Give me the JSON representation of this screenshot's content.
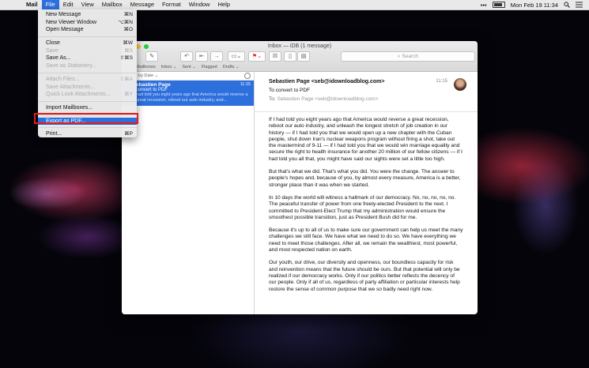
{
  "menubar": {
    "apple_icon": "apple-logo-icon",
    "items": [
      "Mail",
      "File",
      "Edit",
      "View",
      "Mailbox",
      "Message",
      "Format",
      "Window",
      "Help"
    ],
    "active_item": "File",
    "status": {
      "more": "•••",
      "datetime": "Mon Feb 19  11:34",
      "icons": [
        "battery-icon",
        "spotlight-icon",
        "notification-center-icon"
      ]
    }
  },
  "file_menu": {
    "groups": [
      [
        {
          "label": "New Message",
          "shortcut": "⌘N",
          "enabled": true
        },
        {
          "label": "New Viewer Window",
          "shortcut": "⌥⌘N",
          "enabled": true
        },
        {
          "label": "Open Message",
          "shortcut": "⌘O",
          "enabled": true
        }
      ],
      [
        {
          "label": "Close",
          "shortcut": "⌘W",
          "enabled": true
        },
        {
          "label": "Save",
          "shortcut": "⌘S",
          "enabled": false
        },
        {
          "label": "Save As...",
          "shortcut": "⇧⌘S",
          "enabled": true
        },
        {
          "label": "Save as Stationery...",
          "shortcut": "",
          "enabled": false
        }
      ],
      [
        {
          "label": "Attach Files...",
          "shortcut": "⇧⌘A",
          "enabled": false
        },
        {
          "label": "Save Attachments...",
          "shortcut": "",
          "enabled": false
        },
        {
          "label": "Quick Look Attachments...",
          "shortcut": "⌘Y",
          "enabled": false
        }
      ],
      [
        {
          "label": "Import Mailboxes...",
          "shortcut": "",
          "enabled": true
        }
      ],
      [
        {
          "label": "Export as PDF...",
          "shortcut": "",
          "enabled": true,
          "active": true
        }
      ],
      [
        {
          "label": "Print...",
          "shortcut": "⌘P",
          "enabled": true
        }
      ]
    ]
  },
  "window": {
    "title": "Inbox — iDB (1 message)",
    "search_placeholder": "Search",
    "favorites": [
      "Mailboxes",
      "Inbox ⌄",
      "Sent ⌄",
      "Flagged",
      "Drafts ⌄"
    ],
    "sort_label": "t by Date ⌄",
    "toolbar_icons": [
      "get-mail-icon",
      "compose-icon",
      "reply-icon",
      "reply-all-icon",
      "forward-icon",
      "move-icon",
      "flag-icon",
      "junk-icon",
      "delete-icon",
      "archive-icon"
    ]
  },
  "message_list": [
    {
      "sender": "ebastien Page",
      "time": "11:15",
      "subject": "convert to PDF",
      "preview": "had told you eight years ago that America would reverse a great recession, reboot our auto industry, and..."
    }
  ],
  "message": {
    "from": "Sebastien Page <seb@idownloadblog.com>",
    "time": "11:15",
    "subject": "To convert to PDF",
    "to_label": "To:",
    "to": "Sebastien Page <seb@idownloadblog.com>",
    "paragraphs": [
      "If I had told you eight years ago that America would reverse a great recession, reboot our auto industry, and unleash the longest stretch of job creation in our history — if I had told you that we would open up a new chapter with the Cuban people, shut down Iran's nuclear weapons program without firing a shot, take out the mastermind of 9-11 — if I had told you that we would win marriage equality and secure the right to health insurance for another 20 million of our fellow citizens — if I had told you all that, you might have said our sights were set a little too high.",
      "But that's what we did. That's what you did. You were the change. The answer to people's hopes and, because of you, by almost every measure, America is a better, stronger place than it was when we started.",
      "In 10 days the world will witness a hallmark of our democracy. No, no, no, no, no. The peaceful transfer of power from one freely-elected President to the next. I committed to President-Elect Trump that my administration would ensure the smoothest possible transition, just as President Bush did for me.",
      "Because it's up to all of us to make sure our government can help us meet the many challenges we still face. We have what we need to do so. We have everything we need to meet those challenges. After all, we remain the wealthiest, most powerful, and most respected nation on earth.",
      "Our youth, our drive, our diversity and openness, our boundless capacity for risk and reinvention means that the future should be ours. But that potential will only be realized if our democracy works. Only if our politics better reflects the decency of our people. Only if all of us, regardless of party affiliation or particular interests help restore the sense of common purpose that we so badly need right now."
    ]
  },
  "colors": {
    "accent": "#2d6fdc",
    "highlight_box": "#e21b1b"
  }
}
